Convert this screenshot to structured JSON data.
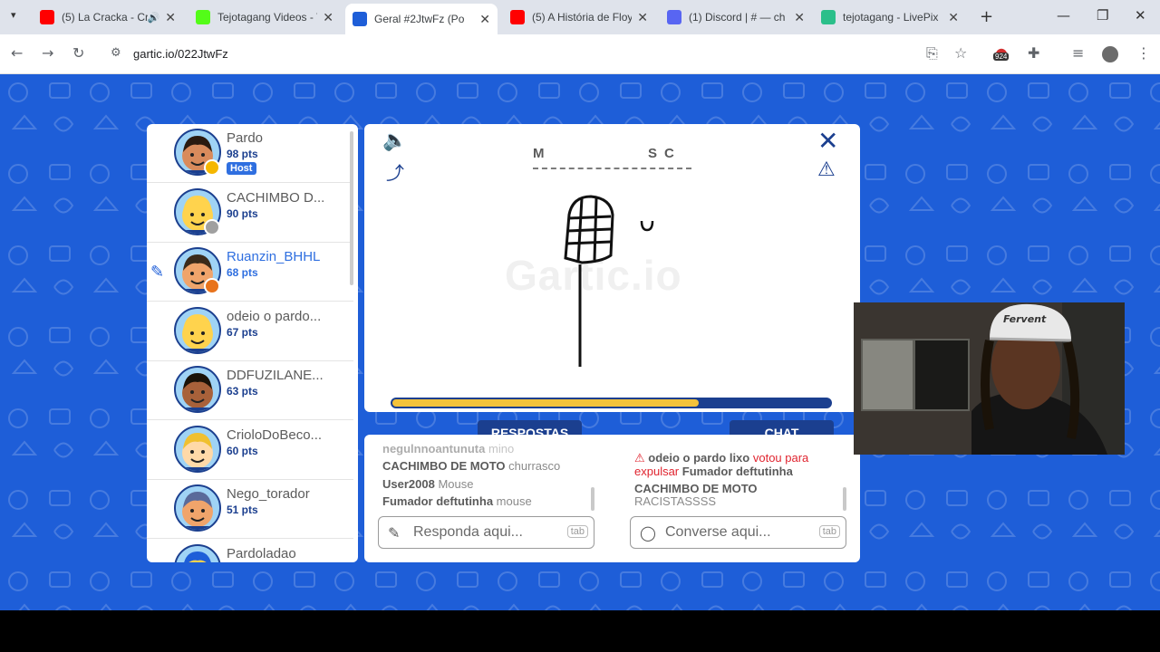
{
  "browser": {
    "tabs": [
      {
        "title": "(5) La Cracka - Cr",
        "favicon": "youtube-icon",
        "color": "#ff0000",
        "audio": true
      },
      {
        "title": "Tejotagang Videos - V",
        "favicon": "kick-icon",
        "color": "#53fc18"
      },
      {
        "title": "Geral #2JtwFz (Po",
        "favicon": "gartic-icon",
        "color": "#1e5ed8",
        "active": true
      },
      {
        "title": "(5) A História de Floy",
        "favicon": "youtube-icon",
        "color": "#ff0000"
      },
      {
        "title": "(1) Discord | # — ch",
        "favicon": "discord-icon",
        "color": "#5865f2"
      },
      {
        "title": "tejotagang - LivePix",
        "favicon": "livepix-icon",
        "color": "#2bbf8a"
      }
    ],
    "url": "gartic.io/022JtwFz",
    "extension_badge": "924"
  },
  "game": {
    "hint_letters": [
      "M",
      "S",
      "C"
    ],
    "progress_fraction": 0.7,
    "watermark": "Gartic.io",
    "answers_tab": "RESPOSTAS",
    "chat_tab": "CHAT",
    "answers_placeholder": "Responda aqui...",
    "chat_placeholder": "Converse aqui...",
    "tab_key": "tab"
  },
  "players": [
    {
      "name": "Pardo",
      "pts": "98 pts",
      "host": "Host",
      "skin": "#d98b5c",
      "hair": "#2a1a10",
      "dot": "#f5b700"
    },
    {
      "name": "CACHIMBO D...",
      "pts": "90 pts",
      "skin": "#ffd34d",
      "hair": "#ffd34d",
      "dot": "#a0a0a0"
    },
    {
      "name": "Ruanzin_BHHL",
      "pts": "68 pts",
      "skin": "#f0a46b",
      "hair": "#3a2a1a",
      "dot": "#e8731c",
      "drawing": true
    },
    {
      "name": "odeio o pardo...",
      "pts": "67 pts",
      "skin": "#ffd34d",
      "hair": "#ffd34d"
    },
    {
      "name": "DDFUZILANE...",
      "pts": "63 pts",
      "skin": "#a8613a",
      "hair": "#1a1208"
    },
    {
      "name": "CrioloDoBeco...",
      "pts": "60 pts",
      "skin": "#ffd9a8",
      "hair": "#f0c030"
    },
    {
      "name": "Nego_torador",
      "pts": "51 pts",
      "skin": "#f0a46b",
      "hair": "#5a6a9a"
    },
    {
      "name": "Pardoladao",
      "pts": "",
      "skin": "#ffd34d",
      "hair": "#1e5ed8"
    }
  ],
  "answers": [
    {
      "user": "negulnnoantunuta",
      "word": "mino"
    },
    {
      "user": "CACHIMBO DE MOTO",
      "word": "churrasco"
    },
    {
      "user": "User2008",
      "word": "Mouse"
    },
    {
      "user": "Fumador deftutinha",
      "word": "mouse"
    }
  ],
  "chat": {
    "alert_user": "odeio o pardo lixo",
    "alert_text": "votou para",
    "alert_text2": "expulsar",
    "alert_target": "Fumador deftutinha",
    "msg_user": "CACHIMBO DE MOTO",
    "msg_text": "RACISTASSSS"
  },
  "webcam": {
    "cap_text": "Fervent"
  }
}
